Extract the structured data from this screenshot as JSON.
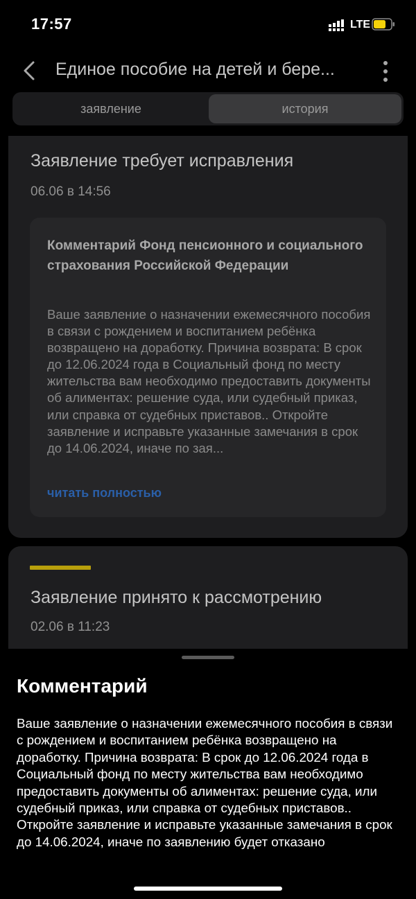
{
  "status_bar": {
    "time": "17:57",
    "network": "LTE",
    "battery_color": "#f5d20a"
  },
  "header": {
    "title": "Единое пособие на детей и бере..."
  },
  "tabs": [
    {
      "label": "заявление",
      "active": false
    },
    {
      "label": "история",
      "active": true
    }
  ],
  "history": [
    {
      "title": "Заявление требует исправления",
      "date": "06.06 в 14:56",
      "comment": {
        "title": "Комментарий Фонд пенсионного и социального страхования Российской Федерации",
        "text": "Ваше заявление о назначении ежемесячного пособия в связи с рождением и воспитанием ребёнка возвращено на доработку. Причина возврата: В срок до 12.06.2024 года в Социальный фонд по месту жительства вам необходимо предоставить документы об алиментах: решение суда, или судебный приказ, или справка от судебных приставов.. Откройте заявление и исправьте указанные замечания в срок до 14.06.2024, иначе по зая...",
        "read_more": "читать полностью"
      }
    },
    {
      "title": "Заявление принято к рассмотрению",
      "date": "02.06 в 11:23",
      "accent_color": "#b8a00c"
    }
  ],
  "sheet": {
    "title": "Комментарий",
    "text": "Ваше заявление о назначении ежемесячного пособия в связи с рождением и воспитанием ребёнка возвращено на доработку. Причина возврата: В срок до 12.06.2024 года в Социальный фонд по месту жительства вам необходимо предоставить документы об алиментах: решение суда, или судебный приказ, или справка от судебных приставов.. Откройте заявление и исправьте указанные замечания в срок до 14.06.2024, иначе по заявлению будет отказано"
  }
}
